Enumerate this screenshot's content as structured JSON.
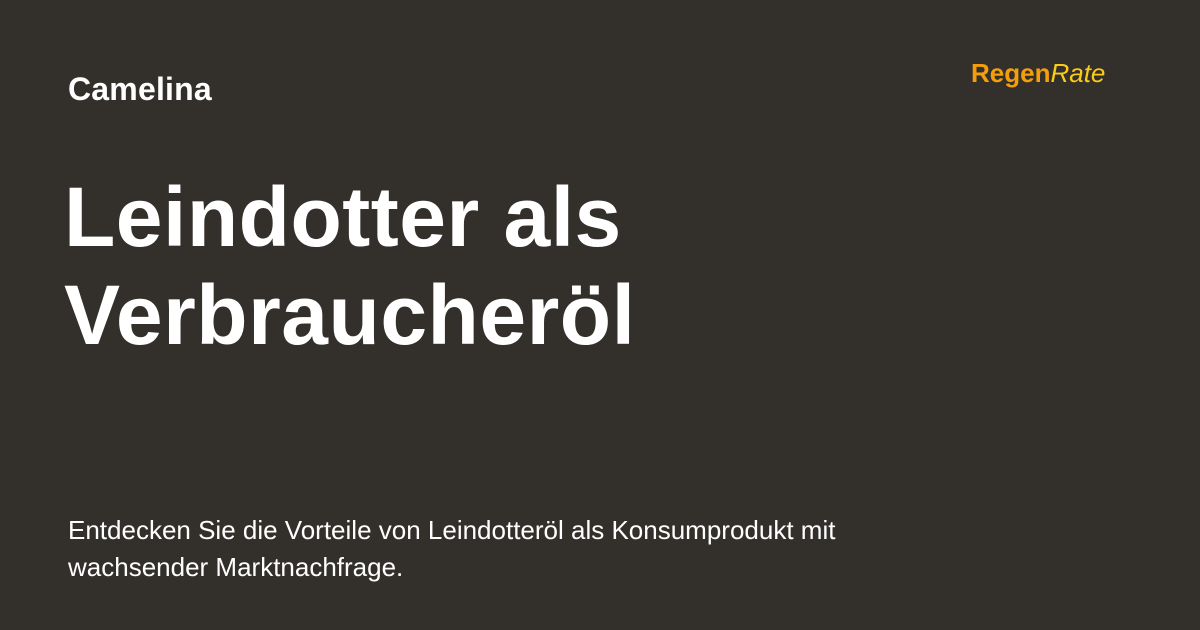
{
  "category": "Camelina",
  "logo": {
    "part1": "Regen",
    "part2": "Rate"
  },
  "headline": {
    "line1": "Leindotter als",
    "line2": "Verbraucheröl"
  },
  "description": {
    "line1": "Entdecken Sie die Vorteile von Leindotteröl als Konsumprodukt mit",
    "line2": "wachsender Marktnachfrage."
  },
  "colors": {
    "background": "#33302c",
    "logo_primary": "#f59e0b",
    "logo_secondary": "#facc15",
    "text": "#ffffff"
  }
}
